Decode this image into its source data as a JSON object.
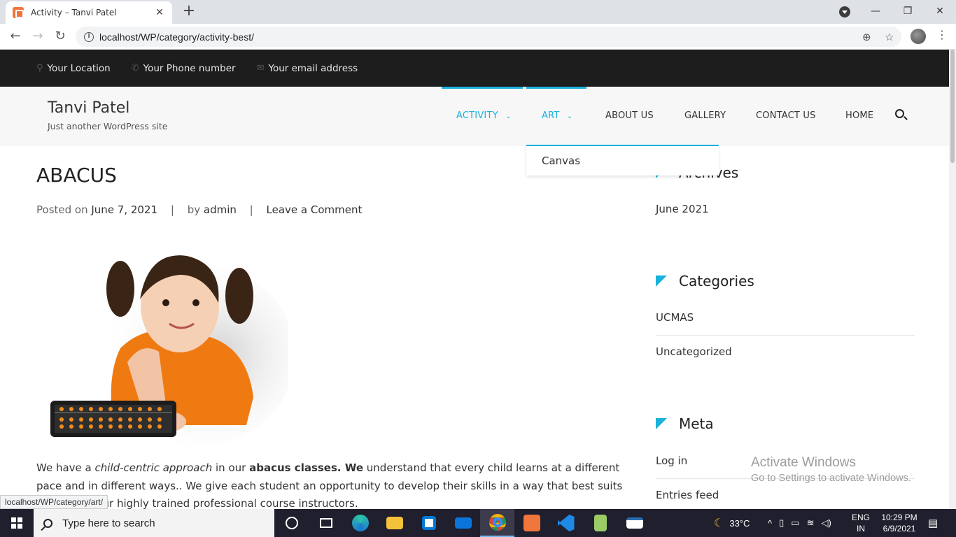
{
  "browser": {
    "tab_title": "Activity – Tanvi Patel",
    "url": "localhost/WP/category/activity-best/",
    "status_url": "localhost/WP/category/art/"
  },
  "topbar": {
    "location": "Your Location",
    "phone": "Your Phone number",
    "email": "Your email address"
  },
  "site": {
    "title": "Tanvi Patel",
    "description": "Just another WordPress site"
  },
  "menu": {
    "items": [
      "ACTIVITY",
      "ART",
      "ABOUT US",
      "GALLERY",
      "CONTACT US",
      "HOME"
    ],
    "dropdown_item": "Canvas"
  },
  "post": {
    "title": "ABACUS",
    "posted_on_label": "Posted on",
    "date": "June 7, 2021",
    "by_label": "by",
    "author": "admin",
    "comment_link": "Leave a Comment",
    "body_1": "We have a ",
    "body_2": "child-centric approach",
    "body_3": " in our ",
    "body_4": "abacus classes. We",
    "body_5": " understand that every child learns at a different pace and in different ways.. We give each student an opportunity to develop their skills in a way that best suits them, with our highly trained professional course instructors."
  },
  "sidebar": {
    "archives_title": "Archives",
    "archives": [
      "June 2021"
    ],
    "categories_title": "Categories",
    "categories": [
      "UCMAS",
      "Uncategorized"
    ],
    "meta_title": "Meta",
    "meta": [
      "Log in",
      "Entries feed"
    ]
  },
  "watermark": {
    "line1": "Activate Windows",
    "line2": "Go to Settings to activate Windows."
  },
  "taskbar": {
    "search_placeholder": "Type here to search",
    "weather": "33°C",
    "lang_1": "ENG",
    "lang_2": "IN",
    "time": "10:29 PM",
    "date": "6/9/2021"
  },
  "colors": {
    "accent": "#1ab2dc",
    "topbar_bg": "#1d1d1d",
    "header_bg": "#f7f7f7"
  }
}
